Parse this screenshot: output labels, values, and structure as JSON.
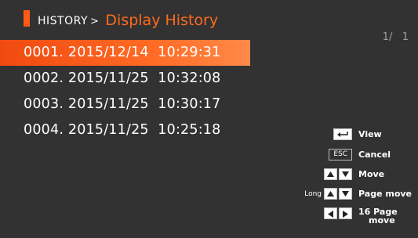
{
  "header": {
    "breadcrumb": "HISTORY",
    "separator": ">",
    "title": "Display History",
    "page_indicator": "1/   1",
    "accent_color": "#ff5a14"
  },
  "history": [
    {
      "index": "0001.",
      "date": "2015/12/14",
      "time": "10:29:31",
      "selected": true
    },
    {
      "index": "0002.",
      "date": "2015/11/25",
      "time": "10:32:08",
      "selected": false
    },
    {
      "index": "0003.",
      "date": "2015/11/25",
      "time": "10:30:17",
      "selected": false
    },
    {
      "index": "0004.",
      "date": "2015/11/25",
      "time": "10:25:18",
      "selected": false
    }
  ],
  "legend": {
    "view": {
      "icon": "enter-key-icon",
      "label": "View"
    },
    "cancel": {
      "key": "ESC",
      "label": "Cancel"
    },
    "move": {
      "icon": "up-down-arrows-icon",
      "label": "Move"
    },
    "page_move": {
      "prefix": "Long",
      "icon": "up-down-arrows-icon",
      "label": "Page move"
    },
    "page16_move": {
      "icon": "left-right-arrows-icon",
      "label_line1": "16 Page",
      "label_line2": "move"
    }
  }
}
